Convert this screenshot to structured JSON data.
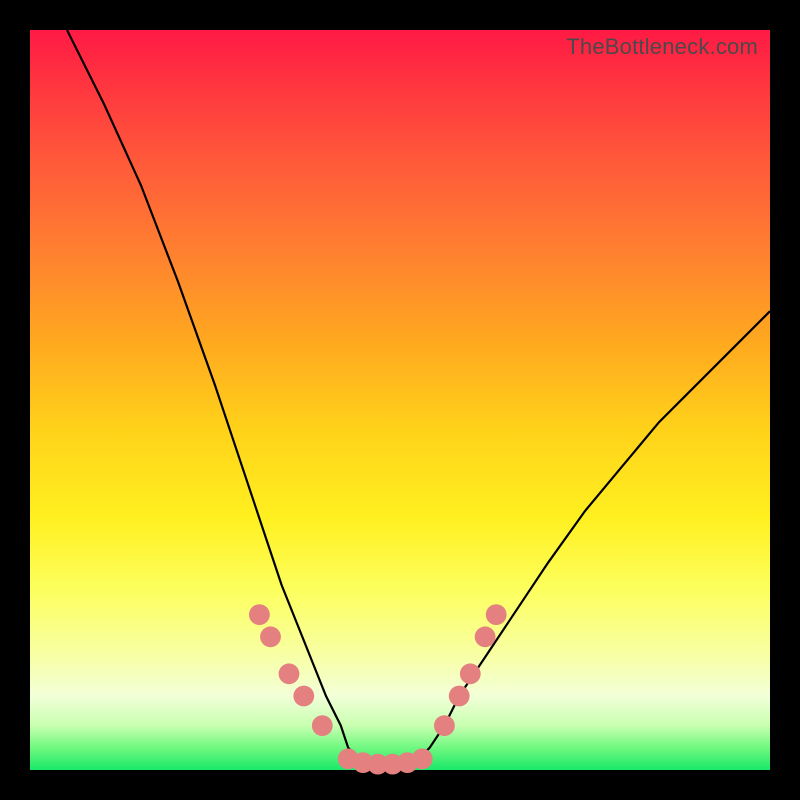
{
  "watermark": "TheBottleneck.com",
  "colors": {
    "frame_bg": "#000000",
    "gradient_top": "#ff1a45",
    "gradient_mid": "#fff020",
    "gradient_bottom": "#18e868",
    "curve_stroke": "#000000",
    "marker_fill": "#e58080"
  },
  "chart_data": {
    "type": "line",
    "title": "",
    "xlabel": "",
    "ylabel": "",
    "xlim": [
      0,
      100
    ],
    "ylim": [
      0,
      100
    ],
    "grid": false,
    "legend": false,
    "description": "Single V-shaped bottleneck curve over a vertical rainbow gradient. Y-axis reads as percentage bottleneck (inverted: green/good at bottom, red/bad at top). The curve dips to ~0% around x≈43–52, rising steeply toward both sides. Pink circular markers sit along the curve near the trough on both arms.",
    "series": [
      {
        "name": "bottleneck-curve",
        "x": [
          5,
          10,
          15,
          20,
          25,
          28,
          30,
          32,
          34,
          36,
          38,
          40,
          42,
          43,
          45,
          48,
          50,
          52,
          54,
          56,
          58,
          60,
          62,
          66,
          70,
          75,
          80,
          85,
          90,
          95,
          100
        ],
        "values": [
          100,
          90,
          79,
          66,
          52,
          43,
          37,
          31,
          25,
          20,
          15,
          10,
          6,
          3,
          1,
          0,
          0,
          1,
          3,
          6,
          10,
          13,
          16,
          22,
          28,
          35,
          41,
          47,
          52,
          57,
          62
        ]
      }
    ],
    "markers": {
      "name": "highlighted-points",
      "shape": "circle",
      "radius_pct": 1.4,
      "points": [
        {
          "x": 31,
          "y": 21
        },
        {
          "x": 32.5,
          "y": 18
        },
        {
          "x": 35,
          "y": 13
        },
        {
          "x": 37,
          "y": 10
        },
        {
          "x": 39.5,
          "y": 6
        },
        {
          "x": 43,
          "y": 1.5
        },
        {
          "x": 45,
          "y": 1
        },
        {
          "x": 47,
          "y": 0.8
        },
        {
          "x": 49,
          "y": 0.8
        },
        {
          "x": 51,
          "y": 1
        },
        {
          "x": 53,
          "y": 1.5
        },
        {
          "x": 56,
          "y": 6
        },
        {
          "x": 58,
          "y": 10
        },
        {
          "x": 59.5,
          "y": 13
        },
        {
          "x": 61.5,
          "y": 18
        },
        {
          "x": 63,
          "y": 21
        }
      ]
    }
  }
}
